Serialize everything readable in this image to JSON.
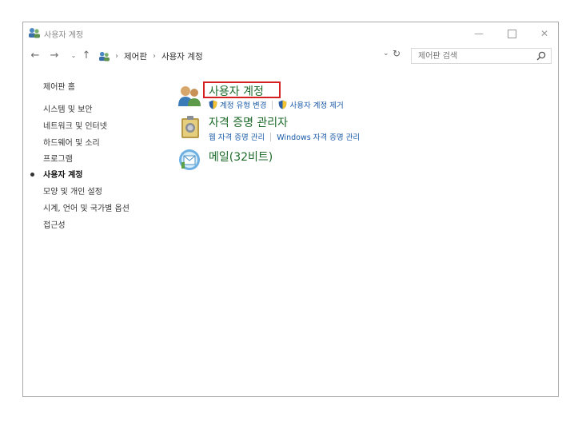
{
  "window": {
    "title": "사용자 계정",
    "min_glyph": "—",
    "close_glyph": "✕"
  },
  "nav": {
    "back": "←",
    "forward": "→",
    "recent": "⌄",
    "up": "↑",
    "breadcrumb": [
      "제어판",
      "사용자 계정"
    ],
    "separator": "›",
    "dropdown": "⌄",
    "refresh": "↻",
    "search_placeholder": "제어판 검색"
  },
  "sidebar": {
    "items": [
      {
        "label": "제어판 홈"
      },
      {
        "label": "시스템 및 보안"
      },
      {
        "label": "네트워크 및 인터넷"
      },
      {
        "label": "하드웨어 및 소리"
      },
      {
        "label": "프로그램"
      },
      {
        "label": "사용자 계정",
        "current": true
      },
      {
        "label": "모양 및 개인 설정"
      },
      {
        "label": "시계, 언어 및 국가별 옵션"
      },
      {
        "label": "접근성"
      }
    ]
  },
  "categories": [
    {
      "title": "사용자 계정",
      "links": [
        "계정 유형 변경",
        "사용자 계정 제거"
      ]
    },
    {
      "title": "자격 증명 관리자",
      "links": [
        "웹 자격 증명 관리",
        "Windows 자격 증명 관리"
      ]
    },
    {
      "title": "메일(32비트)",
      "links": []
    }
  ],
  "colors": {
    "category_title": "#1e6b2b",
    "link": "#1a5aa8",
    "highlight_border": "#d42020"
  }
}
